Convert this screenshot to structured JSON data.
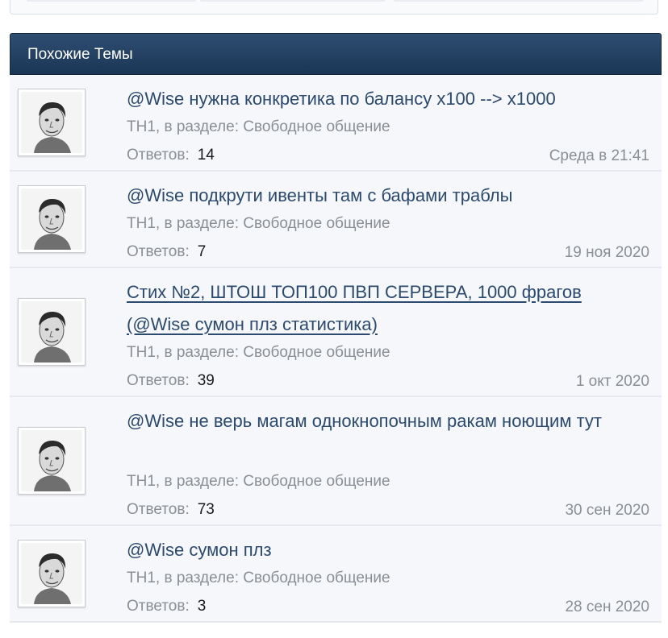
{
  "colors": {
    "header_bg": "#1f3a5c",
    "row_bg": "#f5f7fa",
    "title": "#2c4a6d",
    "muted": "#8a8f96"
  },
  "similar_threads": {
    "header": "Похожие Темы",
    "threads": [
      {
        "title": "@Wise нужна конкретика по балансу х100 --> х1000",
        "forum_line": "TH1, в разделе: Свободное общение",
        "replies_label": "Ответов:",
        "replies": "14",
        "date": "Среда в 21:41",
        "avatar_icon": "user-avatar-icon"
      },
      {
        "title": "@Wise подкрути ивенты там с бафами траблы",
        "forum_line": "TH1, в разделе: Свободное общение",
        "replies_label": "Ответов:",
        "replies": "7",
        "date": "19 ноя 2020",
        "avatar_icon": "user-avatar-icon"
      },
      {
        "title": "Стих №2, ШТОШ ТОП100 ПВП СЕРВЕРА, 1000 фрагов (@Wise сумон плз статистика)",
        "forum_line": "TH1, в разделе: Свободное общение",
        "replies_label": "Ответов:",
        "replies": "39",
        "date": "1 окт 2020",
        "avatar_icon": "user-avatar-icon"
      },
      {
        "title": "@Wise не верь магам однокнопочным ракам ноющим тут",
        "forum_line": "TH1, в разделе: Свободное общение",
        "replies_label": "Ответов:",
        "replies": "73",
        "date": "30 сен 2020",
        "avatar_icon": "user-avatar-icon"
      },
      {
        "title": "@Wise сумон плз",
        "forum_line": "TH1, в разделе: Свободное общение",
        "replies_label": "Ответов:",
        "replies": "3",
        "date": "28 сен 2020",
        "avatar_icon": "user-avatar-icon"
      }
    ]
  }
}
